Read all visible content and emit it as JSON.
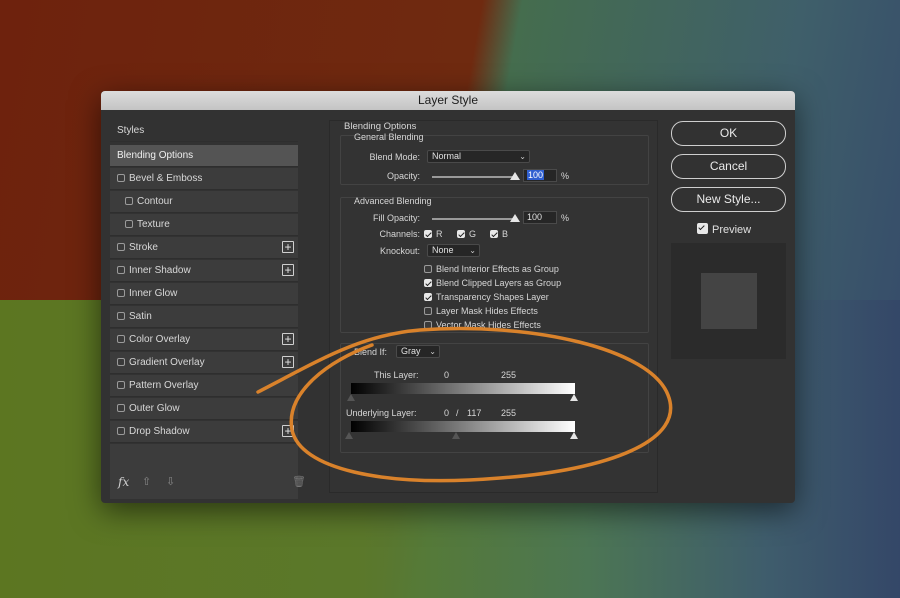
{
  "window": {
    "title": "Layer Style"
  },
  "sidebar": {
    "header": "Styles",
    "items": [
      {
        "label": "Blending Options",
        "active": true,
        "checkbox": false,
        "plus": false,
        "indent": false
      },
      {
        "label": "Bevel & Emboss",
        "checkbox": true,
        "plus": false,
        "indent": false
      },
      {
        "label": "Contour",
        "checkbox": true,
        "plus": false,
        "indent": true
      },
      {
        "label": "Texture",
        "checkbox": true,
        "plus": false,
        "indent": true
      },
      {
        "label": "Stroke",
        "checkbox": true,
        "plus": true,
        "indent": false
      },
      {
        "label": "Inner Shadow",
        "checkbox": true,
        "plus": true,
        "indent": false
      },
      {
        "label": "Inner Glow",
        "checkbox": true,
        "plus": false,
        "indent": false
      },
      {
        "label": "Satin",
        "checkbox": true,
        "plus": false,
        "indent": false
      },
      {
        "label": "Color Overlay",
        "checkbox": true,
        "plus": true,
        "indent": false
      },
      {
        "label": "Gradient Overlay",
        "checkbox": true,
        "plus": true,
        "indent": false
      },
      {
        "label": "Pattern Overlay",
        "checkbox": true,
        "plus": false,
        "indent": false
      },
      {
        "label": "Outer Glow",
        "checkbox": true,
        "plus": false,
        "indent": false
      },
      {
        "label": "Drop Shadow",
        "checkbox": true,
        "plus": true,
        "indent": false
      }
    ],
    "footer": {
      "fx_label": "fx"
    }
  },
  "blending": {
    "section_title": "Blending Options",
    "general": {
      "title": "General Blending",
      "blend_mode_label": "Blend Mode:",
      "blend_mode_value": "Normal",
      "opacity_label": "Opacity:",
      "opacity_value": "100",
      "opacity_unit": "%"
    },
    "advanced": {
      "title": "Advanced Blending",
      "fill_opacity_label": "Fill Opacity:",
      "fill_opacity_value": "100",
      "fill_opacity_unit": "%",
      "channels_label": "Channels:",
      "channel_r": "R",
      "channel_g": "G",
      "channel_b": "B",
      "knockout_label": "Knockout:",
      "knockout_value": "None",
      "options": [
        {
          "label": "Blend Interior Effects as Group",
          "checked": false
        },
        {
          "label": "Blend Clipped Layers as Group",
          "checked": true
        },
        {
          "label": "Transparency Shapes Layer",
          "checked": true
        },
        {
          "label": "Layer Mask Hides Effects",
          "checked": false
        },
        {
          "label": "Vector Mask Hides Effects",
          "checked": false
        }
      ]
    },
    "blend_if": {
      "label": "Blend If:",
      "value": "Gray",
      "this_layer_label": "This Layer:",
      "this_layer_low": "0",
      "this_layer_high": "255",
      "underlying_label": "Underlying Layer:",
      "underlying_low": "0",
      "underlying_sep": "/",
      "underlying_mid": "117",
      "underlying_high": "255"
    }
  },
  "buttons": {
    "ok": "OK",
    "cancel": "Cancel",
    "new_style": "New Style...",
    "preview_label": "Preview"
  },
  "annotation": {
    "color": "#d9822b"
  }
}
